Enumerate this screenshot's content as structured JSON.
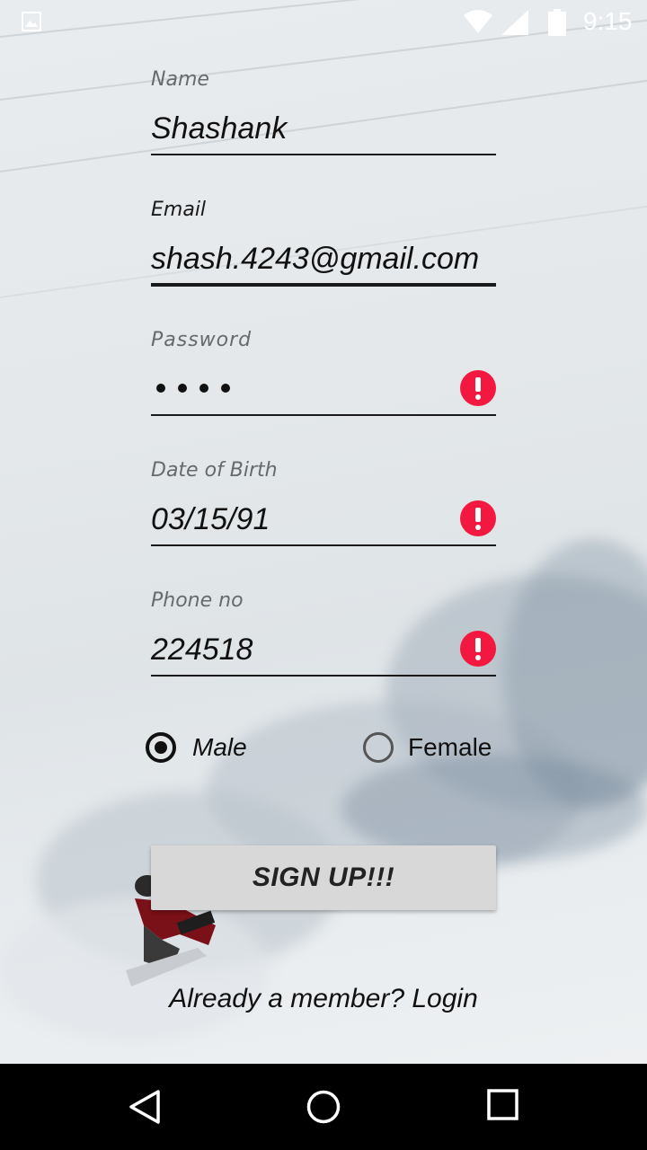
{
  "status_bar": {
    "time": "9:15",
    "icons": [
      "gallery-icon",
      "wifi-icon",
      "signal-icon",
      "battery-icon"
    ]
  },
  "form": {
    "name": {
      "label": "Name",
      "value": "Shashank"
    },
    "email": {
      "label": "Email",
      "value": "shash.4243@gmail.com"
    },
    "password": {
      "label": "Password",
      "masked_length": 4,
      "error_icon": "error-icon"
    },
    "dob": {
      "label": "Date of Birth",
      "value": "03/15/91",
      "error_icon": "error-icon"
    },
    "phone": {
      "label": "Phone no",
      "value": "224518",
      "error_icon": "error-icon"
    },
    "gender": {
      "options": [
        {
          "label": "Male",
          "selected": true
        },
        {
          "label": "Female",
          "selected": false
        }
      ]
    },
    "signup_label": "SIGN UP!!!",
    "login_text": "Already a member? Login"
  },
  "nav_bar": {
    "buttons": [
      "back-icon",
      "home-icon",
      "recents-icon"
    ]
  },
  "colors": {
    "error": "#f2183f",
    "button_bg": "#d8d8d8",
    "nav_bg": "#000000"
  }
}
